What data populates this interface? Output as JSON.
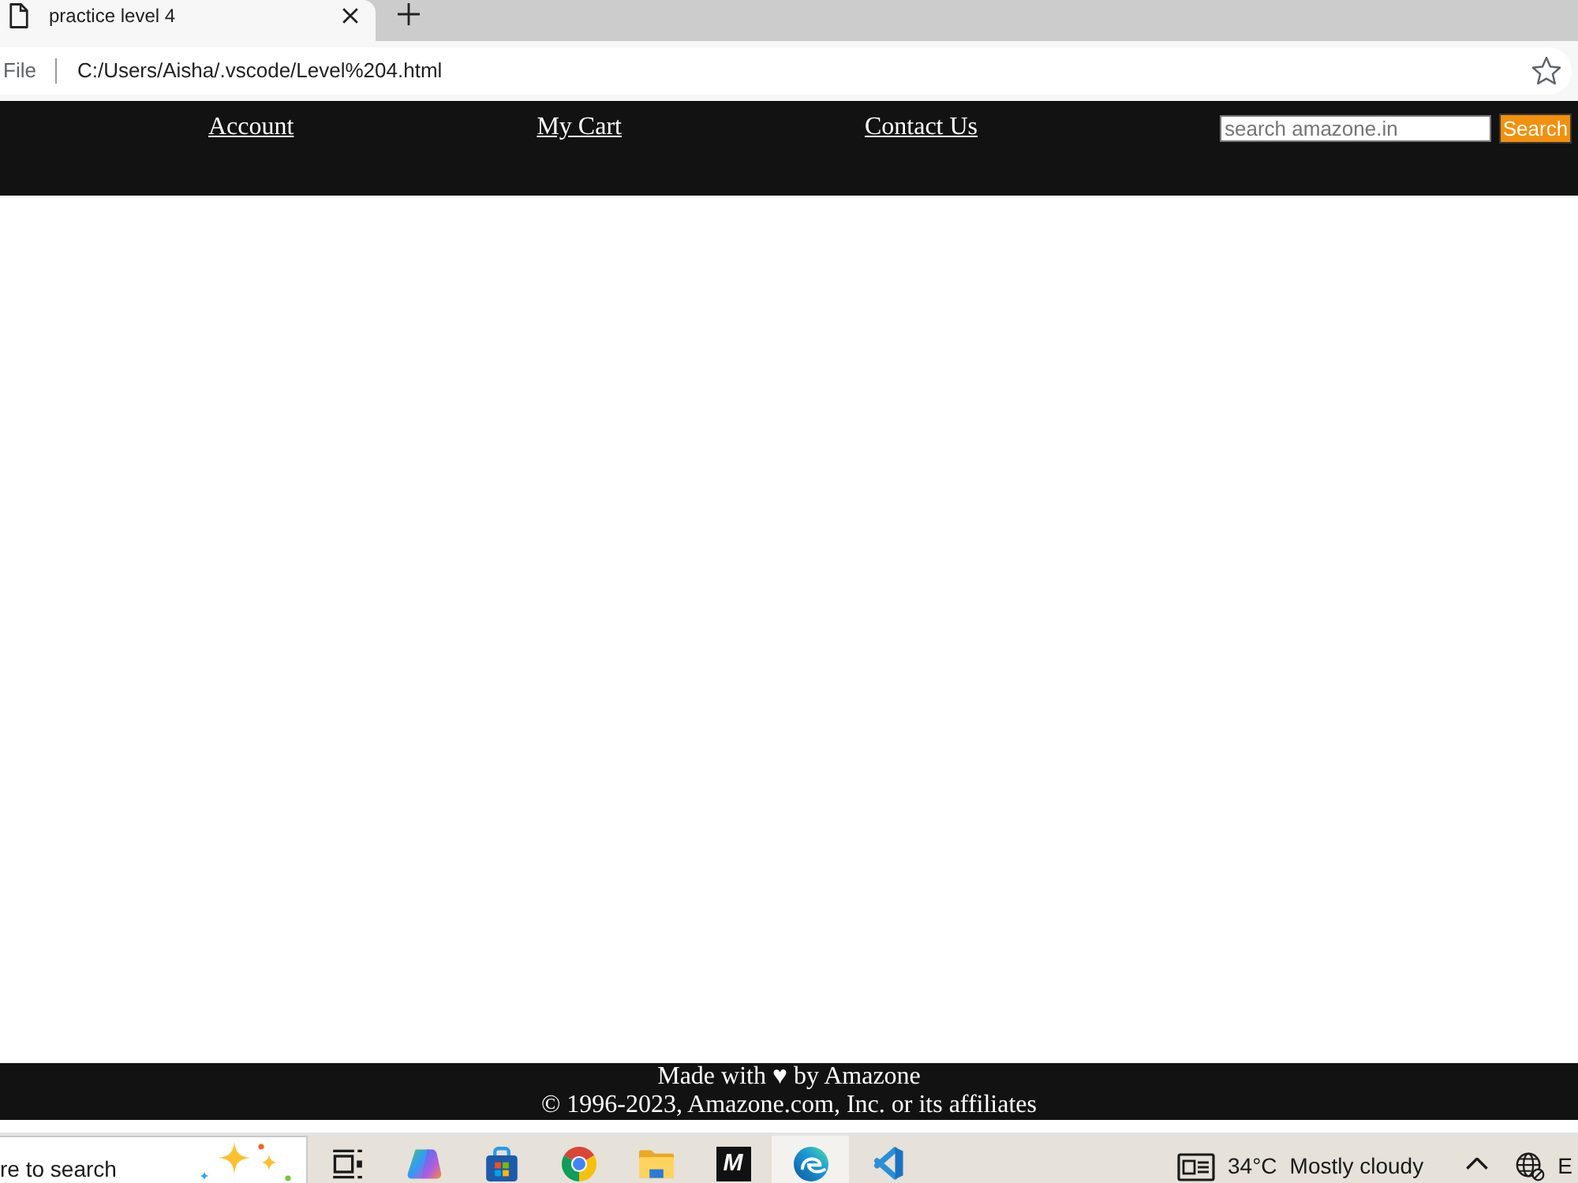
{
  "browser": {
    "tabs": [
      {
        "title": "practice level 4",
        "selected": true
      }
    ],
    "address_bar": {
      "scheme": "File",
      "url": "C:/Users/Aisha/.vscode/Level%204.html"
    }
  },
  "page": {
    "nav": {
      "links": [
        "Account",
        "My Cart",
        "Contact Us"
      ],
      "search": {
        "placeholder": "search amazone.in",
        "button": "Search"
      }
    },
    "footer": {
      "lines": [
        "Made with ♥ by Amazone",
        "© 1996-2023, Amazone.com, Inc. or its affiliates"
      ]
    }
  },
  "taskbar": {
    "search": {
      "placeholder": "re to search"
    },
    "apps": [
      {
        "kind": "task-view",
        "selected": false
      },
      {
        "kind": "swirl",
        "selected": false
      },
      {
        "kind": "bag",
        "selected": false
      },
      {
        "kind": "tricolor-circle",
        "selected": false
      },
      {
        "kind": "folder",
        "selected": false
      },
      {
        "kind": "letter-tile",
        "label": "M",
        "selected": false
      },
      {
        "kind": "wave",
        "selected": true
      },
      {
        "kind": "ribbon",
        "selected": false
      }
    ],
    "weather": {
      "temperature": "34°C",
      "condition": "Mostly cloudy"
    },
    "language": "E"
  }
}
